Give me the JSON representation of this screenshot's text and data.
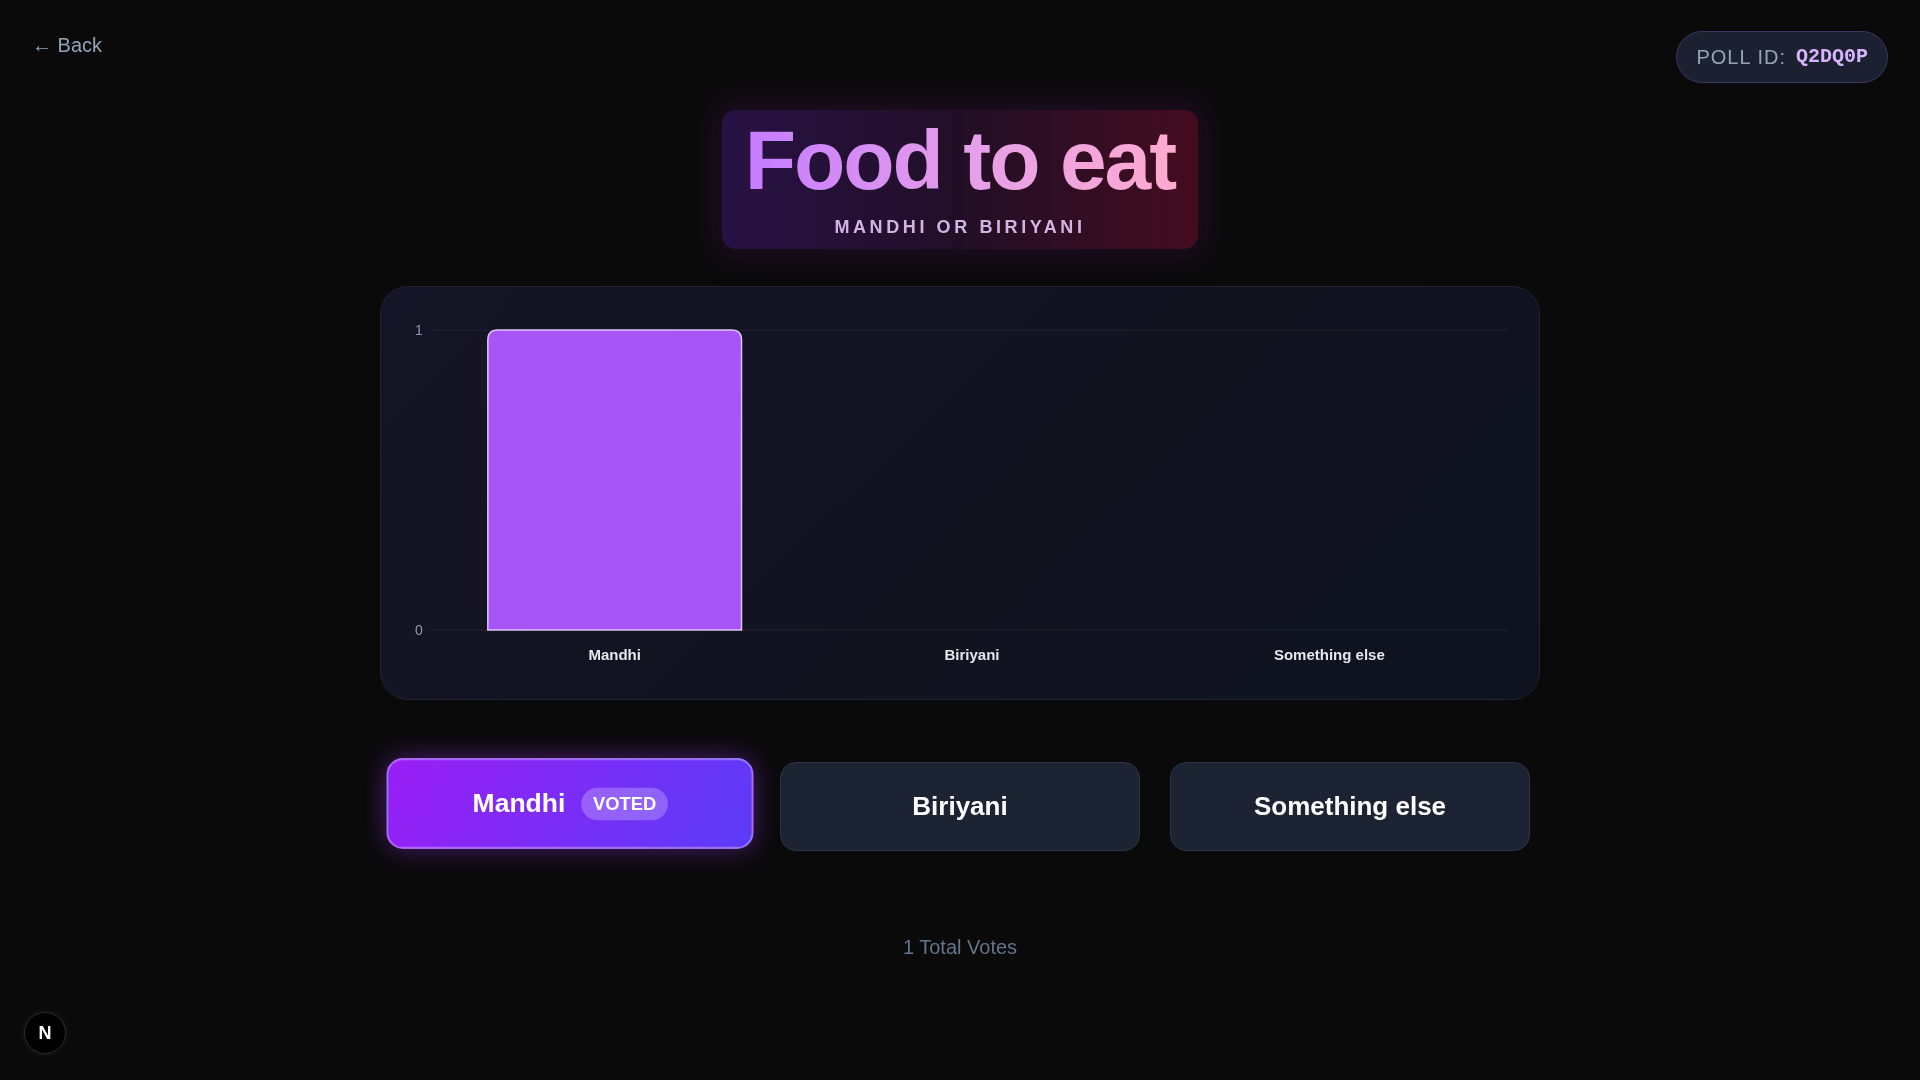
{
  "back_link": {
    "label": "← Back"
  },
  "poll_id": {
    "label": "POLL ID:",
    "value": "Q2DQ0P"
  },
  "title": "Food to eat",
  "subtitle": "MANDHI OR BIRIYANI",
  "results_chart": {
    "chart_data": {
      "type": "bar",
      "categories": [
        "Mandhi",
        "Biriyani",
        "Something else"
      ],
      "values": [
        1,
        0,
        0
      ],
      "ylim": [
        0,
        1
      ],
      "yticks": [
        0,
        1
      ]
    }
  },
  "options": [
    {
      "label": "Mandhi",
      "selected": true,
      "badge": "VOTED"
    },
    {
      "label": "Biriyani",
      "selected": false
    },
    {
      "label": "Something else",
      "selected": false
    }
  ],
  "total_votes": "1 Total Votes",
  "dev_indicator": {
    "label": "N"
  }
}
